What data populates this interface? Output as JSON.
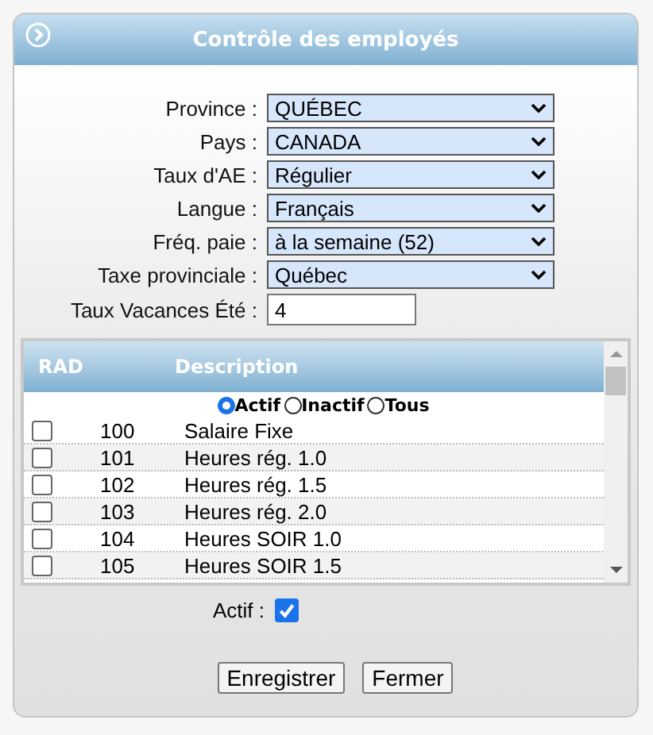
{
  "window": {
    "title": "Contrôle des employés"
  },
  "fields": [
    {
      "kind": "select",
      "label": "Province :",
      "value": "QUÉBEC"
    },
    {
      "kind": "select",
      "label": "Pays :",
      "value": "CANADA"
    },
    {
      "kind": "select",
      "label": "Taux d'AE :",
      "value": "Régulier"
    },
    {
      "kind": "select",
      "label": "Langue :",
      "value": "Français"
    },
    {
      "kind": "select",
      "label": "Fréq. paie :",
      "value": "à la semaine (52)"
    },
    {
      "kind": "select",
      "label": "Taxe provinciale :",
      "value": "Québec"
    },
    {
      "kind": "text",
      "label": "Taux Vacances Été :",
      "value": "4"
    }
  ],
  "table": {
    "columns": [
      "RAD",
      "Description"
    ],
    "filters": [
      {
        "label": "Actif",
        "selected": true
      },
      {
        "label": "Inactif",
        "selected": false
      },
      {
        "label": "Tous",
        "selected": false
      }
    ],
    "rows": [
      {
        "checked": false,
        "code": "100",
        "description": "Salaire Fixe"
      },
      {
        "checked": false,
        "code": "101",
        "description": "Heures rég. 1.0"
      },
      {
        "checked": false,
        "code": "102",
        "description": "Heures rég. 1.5"
      },
      {
        "checked": false,
        "code": "103",
        "description": "Heures rég. 2.0"
      },
      {
        "checked": false,
        "code": "104",
        "description": "Heures SOIR 1.0"
      },
      {
        "checked": false,
        "code": "105",
        "description": "Heures SOIR 1.5"
      }
    ]
  },
  "active": {
    "label": "Actif :",
    "checked": true
  },
  "buttons": [
    "Enregistrer",
    "Fermer"
  ]
}
